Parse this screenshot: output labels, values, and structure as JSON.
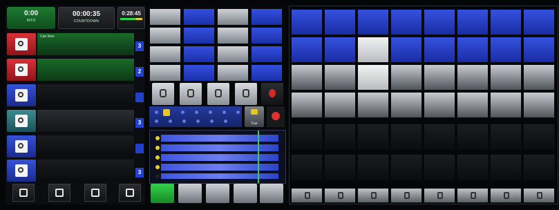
{
  "status": {
    "elapsed": "0:00",
    "elapsed_label": "INTO",
    "remaining": "00:00:35",
    "remaining_label": "COUNTDOWN",
    "clock": "0:28:45"
  },
  "playlist": {
    "items": [
      {
        "title": "Cart Item",
        "line2": "",
        "line3": "",
        "number": "3"
      },
      {
        "title": "",
        "line2": "",
        "line3": "",
        "number": "2"
      },
      {
        "title": "",
        "line2": "",
        "line3": "",
        "number": ""
      },
      {
        "title": "",
        "line2": "",
        "line3": "",
        "number": "3"
      },
      {
        "title": "",
        "line2": "",
        "line3": "",
        "number": ""
      },
      {
        "title": "",
        "line2": "",
        "line3": "",
        "number": "3"
      }
    ]
  },
  "cue_label": "Cue",
  "colors": {
    "accent_blue": "#2340c8",
    "accent_red": "#d8323a",
    "accent_green": "#1f7a33"
  }
}
